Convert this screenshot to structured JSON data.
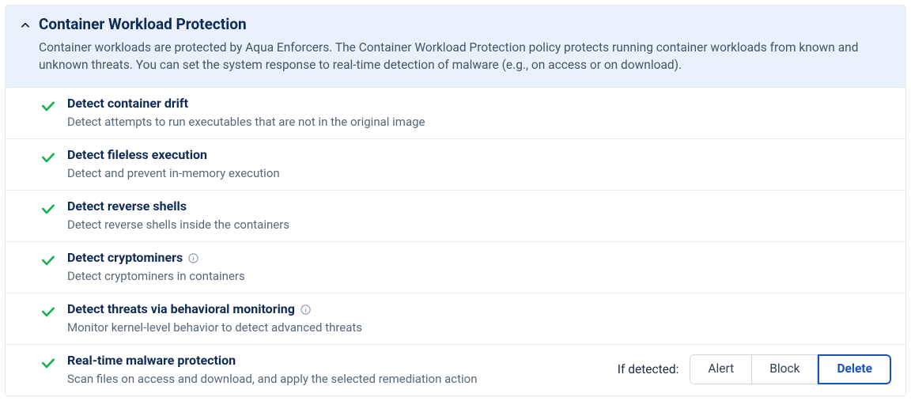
{
  "header": {
    "title": "Container Workload Protection",
    "description": "Container workloads are protected by Aqua Enforcers. The Container Workload Protection policy protects running container workloads from known and unknown threats. You can set the system response to real-time detection of malware (e.g., on access or on download)."
  },
  "items": [
    {
      "title": "Detect container drift",
      "description": "Detect attempts to run executables that are not in the original image",
      "info": false
    },
    {
      "title": "Detect fileless execution",
      "description": "Detect and prevent in-memory execution",
      "info": false
    },
    {
      "title": "Detect reverse shells",
      "description": "Detect reverse shells inside the containers",
      "info": false
    },
    {
      "title": "Detect cryptominers",
      "description": "Detect cryptominers in containers",
      "info": true
    },
    {
      "title": "Detect threats via behavioral monitoring",
      "description": "Monitor kernel-level behavior to detect advanced threats",
      "info": true
    },
    {
      "title": "Real-time malware protection",
      "description": "Scan files on access and download, and apply the selected remediation action",
      "info": false
    }
  ],
  "action": {
    "label": "If detected:",
    "options": [
      "Alert",
      "Block",
      "Delete"
    ],
    "selected": "Delete"
  }
}
